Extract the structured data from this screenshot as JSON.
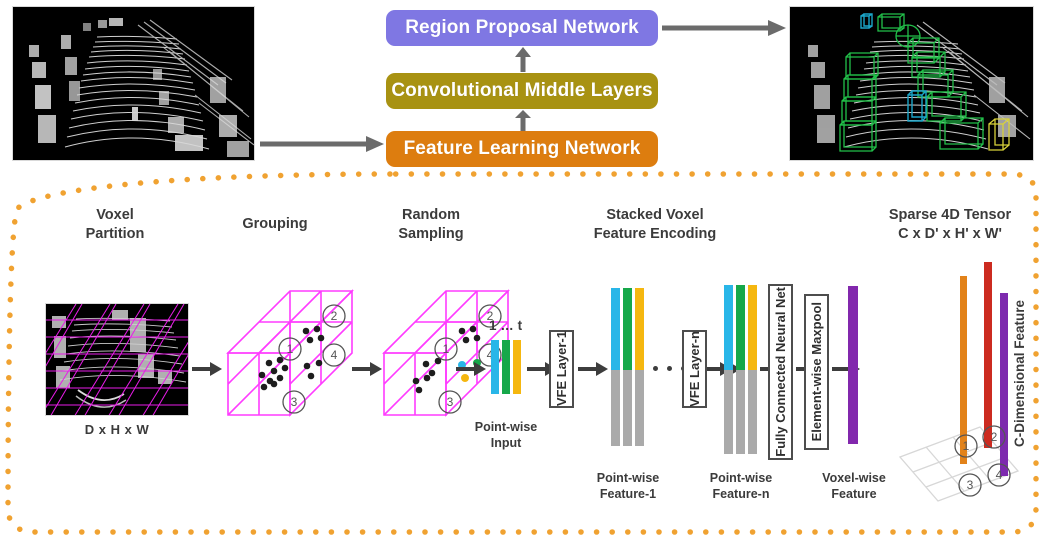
{
  "figure": {
    "title_blocks": [
      {
        "key": "rpn",
        "label": "Region Proposal Network",
        "color": "#7f77e3"
      },
      {
        "key": "cml",
        "label": "Convolutional Middle Layers",
        "color": "#a89212"
      },
      {
        "key": "fln",
        "label": "Feature Learning Network",
        "color": "#dd7d0f"
      }
    ],
    "panel_border_color": "#f0a231"
  },
  "scenes": {
    "input": {
      "name": "raw-lidar-point-cloud"
    },
    "output": {
      "name": "detection-result-point-cloud",
      "box_colors": {
        "car": "#22c04a",
        "pedestrian": "#1ba5c9",
        "cyclist": "#d8d23a"
      }
    },
    "voxel": {
      "name": "voxel-partitioned-point-cloud",
      "grid_color": "#e81ce8"
    }
  },
  "stages": [
    {
      "key": "voxel_partition",
      "label": "Voxel\nPartition"
    },
    {
      "key": "grouping",
      "label": "Grouping"
    },
    {
      "key": "random_sampling",
      "label": "Random\nSampling"
    },
    {
      "key": "stacked_vfe",
      "label": "Stacked Voxel\nFeature Encoding"
    },
    {
      "key": "sparse_tensor",
      "label": "Sparse 4D Tensor\nC x D' x H' x W'"
    }
  ],
  "labels": {
    "dhw": "D x H x W",
    "point_range": "1 ... t",
    "point_wise_input": "Point-wise\nInput",
    "point_wise_feature_1": "Point-wise\nFeature-1",
    "point_wise_feature_n": "Point-wise\nFeature-n",
    "voxel_wise_feature": "Voxel-wise\nFeature",
    "c_dimensional_feature": "C-Dimensional Feature"
  },
  "modules": [
    {
      "key": "vfe1",
      "label": "VFE Layer-1"
    },
    {
      "key": "vfen",
      "label": "VFE Layer-n"
    },
    {
      "key": "fcnn",
      "label": "Fully Connected Neural Net"
    },
    {
      "key": "maxpool",
      "label": "Element-wise Maxpool"
    }
  ],
  "voxel_indices": [
    "1",
    "2",
    "3",
    "4"
  ],
  "colors": {
    "cyan": "#29b6e8",
    "green": "#16a84a",
    "amber": "#f5b70f",
    "grey": "#aaaaaa",
    "purple_bar": "#8228ad",
    "orange_bar": "#e2821a",
    "red_bar": "#cc2b20",
    "violet_bar": "#7d2aae",
    "arrow": "#6b6b6b",
    "arrow_dark": "#3d3d3d",
    "magenta": "#ff3cff"
  },
  "chart_data": {
    "type": "diagram",
    "title": "VoxelNet architecture — Feature Learning Network detail",
    "pipeline": [
      "Feature Learning Network",
      "Convolutional Middle Layers",
      "Region Proposal Network"
    ],
    "feature_learning_steps": [
      "Voxel Partition",
      "Grouping",
      "Random Sampling",
      "Stacked Voxel Feature Encoding",
      "Sparse 4D Tensor"
    ]
  }
}
